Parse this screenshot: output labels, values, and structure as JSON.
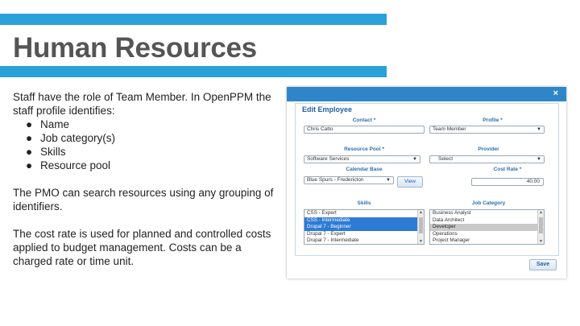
{
  "slide": {
    "title": "Human Resources",
    "intro": "Staff have the role of Team Member. In OpenPPM the staff profile identifies:",
    "bullet_char": "●",
    "bullets": [
      "Name",
      "Job category(s)",
      "Skills",
      "Resource pool"
    ],
    "para2": "The PMO can search resources using any grouping of identifiers.",
    "para3": "The cost rate is used for planned and controlled costs applied to budget management.  Costs can be a charged rate or time unit.",
    "accent_color": "#2aa1d8"
  },
  "dialog": {
    "heading": "Edit Employee",
    "close_glyph": "×",
    "titlebar_color": "#2e86c8",
    "contact": {
      "label": "Contact *",
      "value": "Chris Catto"
    },
    "profile": {
      "label": "Profile *",
      "value": "Team Member"
    },
    "resource_pool": {
      "label": "Resource Pool *",
      "value": "Software Services"
    },
    "provider": {
      "label": "Provider",
      "value": "Select"
    },
    "calendar_base": {
      "label": "Calendar Base",
      "value": "Blue Spurs - Fredericton"
    },
    "view_button": "View",
    "cost_rate": {
      "label": "Cost Rate *",
      "value": "40.00"
    },
    "skills": {
      "label": "Skills",
      "options": [
        {
          "text": "CSS - Expert",
          "state": "normal"
        },
        {
          "text": "CSS - Intermediate",
          "state": "selected"
        },
        {
          "text": "Drupal 7 - Beginner",
          "state": "selected"
        },
        {
          "text": "Drupal 7 - Expert",
          "state": "normal"
        },
        {
          "text": "Drupal 7 - Intermediate",
          "state": "normal"
        }
      ]
    },
    "job_category": {
      "label": "Job Category",
      "options": [
        {
          "text": "Business Analyst",
          "state": "normal"
        },
        {
          "text": "Data Architect",
          "state": "normal"
        },
        {
          "text": "Developer",
          "state": "gray"
        },
        {
          "text": "Operations",
          "state": "normal"
        },
        {
          "text": "Project Manager",
          "state": "normal"
        }
      ]
    },
    "save_button": "Save"
  }
}
